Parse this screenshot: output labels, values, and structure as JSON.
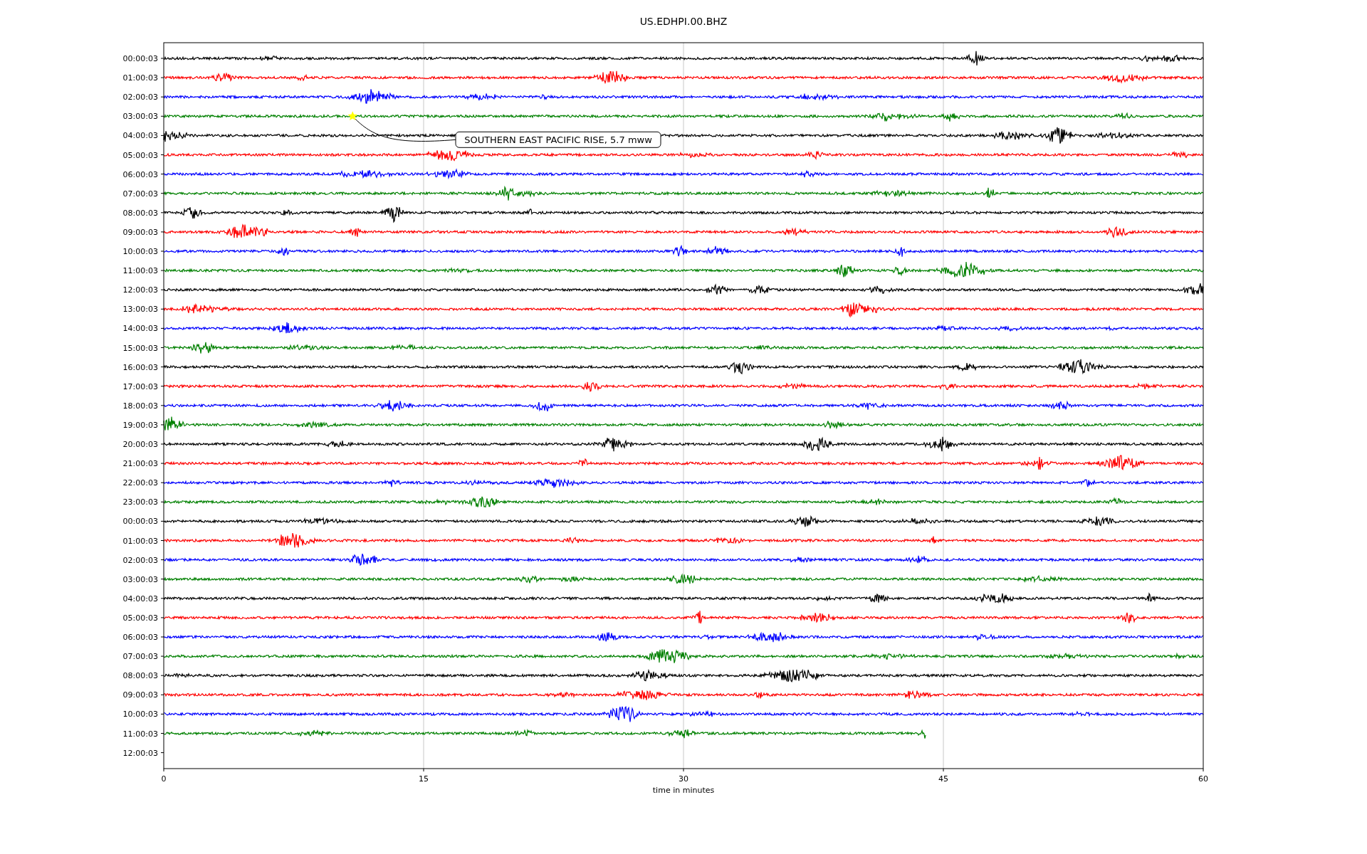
{
  "title": "US.EDHPI.00.BHZ",
  "y_labels": [
    "00:00:03",
    "01:00:03",
    "02:00:03",
    "03:00:03",
    "04:00:03",
    "05:00:03",
    "06:00:03",
    "07:00:03",
    "08:00:03",
    "09:00:03",
    "10:00:03",
    "11:00:03",
    "12:00:03",
    "13:00:03",
    "14:00:03",
    "15:00:03",
    "16:00:03",
    "17:00:03",
    "18:00:03",
    "19:00:03",
    "20:00:03",
    "21:00:03",
    "22:00:03",
    "23:00:03",
    "00:00:03",
    "01:00:03",
    "02:00:03",
    "03:00:03",
    "04:00:03",
    "05:00:03",
    "06:00:03",
    "07:00:03",
    "08:00:03",
    "09:00:03",
    "10:00:03",
    "11:00:03",
    "12:00:03"
  ],
  "x_ticks": [
    "0",
    "15",
    "30",
    "45",
    "60"
  ],
  "xlabel": "time in minutes",
  "event": {
    "label": "SOUTHERN EAST PACIFIC RISE, 5.7 mww"
  },
  "traces": [
    {
      "color": "#000000",
      "level": 1
    },
    {
      "color": "#ff0000",
      "level": 1
    },
    {
      "color": "#0000ff",
      "level": 1
    },
    {
      "color": "#008000",
      "level": 1
    },
    {
      "color": "#000000",
      "level": 1
    },
    {
      "color": "#ff0000",
      "level": 1
    },
    {
      "color": "#0000ff",
      "level": 1
    },
    {
      "color": "#008000",
      "level": 1
    },
    {
      "color": "#000000",
      "level": 1
    },
    {
      "color": "#ff0000",
      "level": 1
    },
    {
      "color": "#0000ff",
      "level": 1
    },
    {
      "color": "#008000",
      "level": 1
    },
    {
      "color": "#000000",
      "level": 1
    },
    {
      "color": "#ff0000",
      "level": 1
    },
    {
      "color": "#0000ff",
      "level": 1
    },
    {
      "color": "#008000",
      "level": 1
    },
    {
      "color": "#000000",
      "level": 1
    },
    {
      "color": "#ff0000",
      "level": 1
    },
    {
      "color": "#0000ff",
      "level": 1
    },
    {
      "color": "#008000",
      "level": 1
    },
    {
      "color": "#000000",
      "level": 1
    },
    {
      "color": "#ff0000",
      "level": 1
    },
    {
      "color": "#0000ff",
      "level": 1
    },
    {
      "color": "#008000",
      "level": 1
    },
    {
      "color": "#000000",
      "level": 1
    },
    {
      "color": "#ff0000",
      "level": 1
    },
    {
      "color": "#0000ff",
      "level": 1
    },
    {
      "color": "#008000",
      "level": 1
    },
    {
      "color": "#000000",
      "level": 1
    },
    {
      "color": "#ff0000",
      "level": 1
    },
    {
      "color": "#0000ff",
      "level": 1
    },
    {
      "color": "#008000",
      "level": 1
    },
    {
      "color": "#000000",
      "level": 1
    },
    {
      "color": "#ff0000",
      "level": 1
    },
    {
      "color": "#0000ff",
      "level": 1
    },
    {
      "color": "#008000",
      "level": 0.733
    }
  ]
}
